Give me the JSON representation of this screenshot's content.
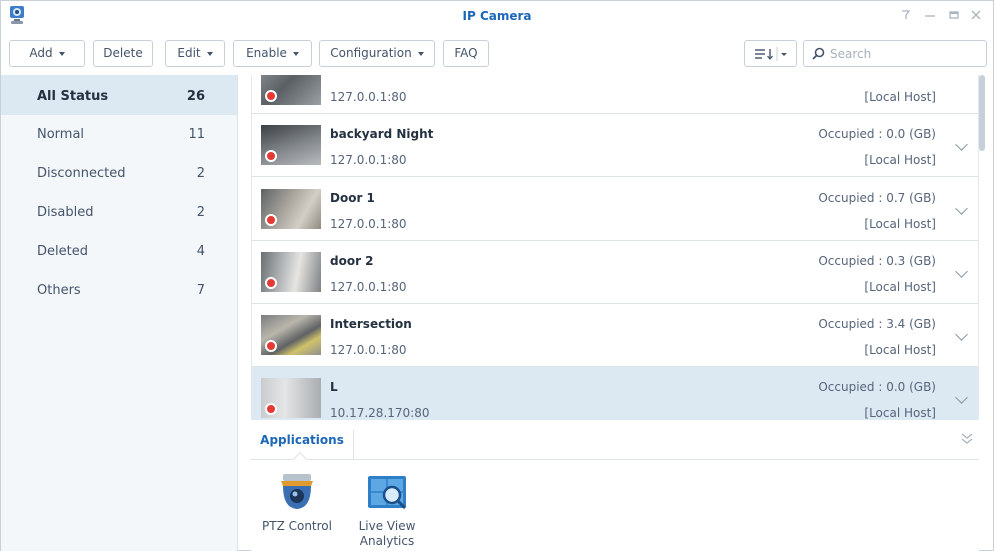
{
  "window": {
    "title": "IP Camera",
    "controls": [
      "pin",
      "minimize",
      "maximize",
      "close"
    ]
  },
  "toolbar": {
    "add": "Add",
    "delete": "Delete",
    "edit": "Edit",
    "enable": "Enable",
    "configuration": "Configuration",
    "faq": "FAQ",
    "search_placeholder": "Search"
  },
  "sidebar": {
    "items": [
      {
        "label": "All Status",
        "count": "26"
      },
      {
        "label": "Normal",
        "count": "11"
      },
      {
        "label": "Disconnected",
        "count": "2"
      },
      {
        "label": "Disabled",
        "count": "2"
      },
      {
        "label": "Deleted",
        "count": "4"
      },
      {
        "label": "Others",
        "count": "7"
      }
    ]
  },
  "cameras": [
    {
      "name": "",
      "ip": "127.0.0.1:80",
      "occupied": "",
      "host": "[Local Host]"
    },
    {
      "name": "backyard Night",
      "ip": "127.0.0.1:80",
      "occupied": "Occupied : 0.0 (GB)",
      "host": "[Local Host]"
    },
    {
      "name": "Door 1",
      "ip": "127.0.0.1:80",
      "occupied": "Occupied : 0.7 (GB)",
      "host": "[Local Host]"
    },
    {
      "name": "door 2",
      "ip": "127.0.0.1:80",
      "occupied": "Occupied : 0.3 (GB)",
      "host": "[Local Host]"
    },
    {
      "name": "Intersection",
      "ip": "127.0.0.1:80",
      "occupied": "Occupied : 3.4 (GB)",
      "host": "[Local Host]"
    },
    {
      "name": "L",
      "ip": "10.17.28.170:80",
      "occupied": "Occupied : 0.0 (GB)",
      "host": "[Local Host]"
    }
  ],
  "applications": {
    "tab": "Applications",
    "items": [
      {
        "label": "PTZ Control",
        "icon": "ptz-camera-icon"
      },
      {
        "label": "Live View Analytics",
        "icon": "live-view-analytics-icon"
      }
    ]
  },
  "colors": {
    "accent": "#1c67b7",
    "selected": "#dce9f3",
    "record": "#e53935"
  }
}
